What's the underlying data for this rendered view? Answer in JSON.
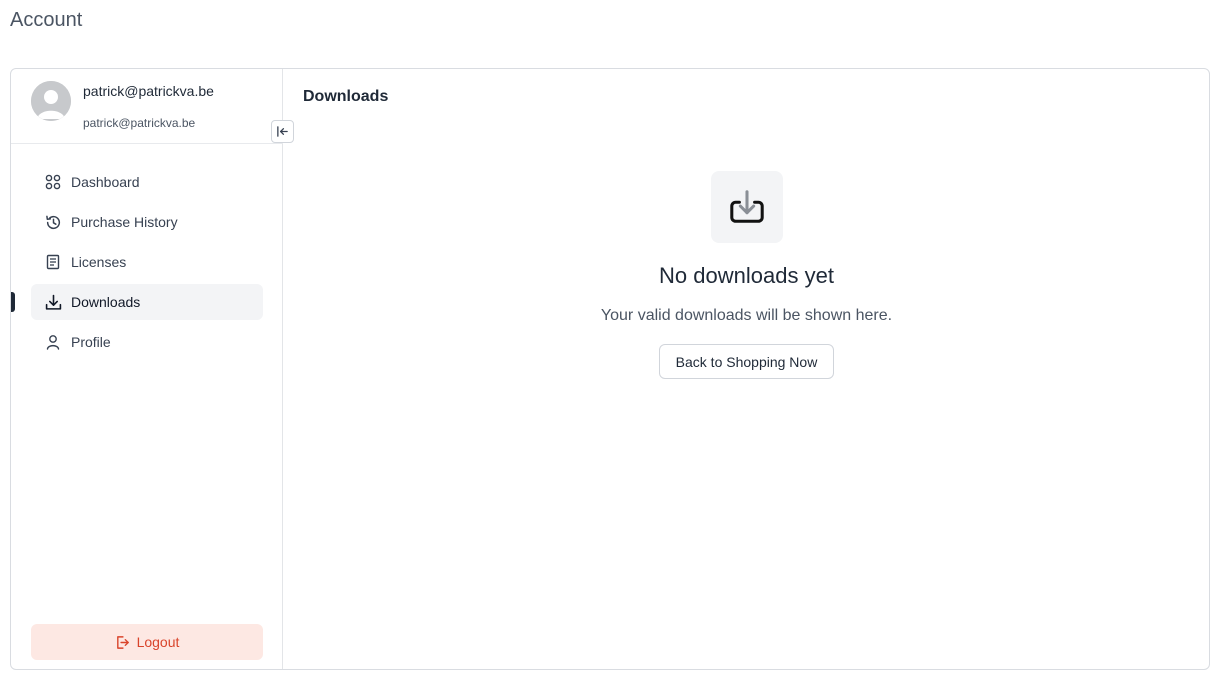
{
  "page": {
    "title": "Account"
  },
  "user": {
    "name": "patrick@patrickva.be",
    "email": "patrick@patrickva.be"
  },
  "sidebar": {
    "items": [
      {
        "label": "Dashboard",
        "icon": "grid-icon",
        "active": false
      },
      {
        "label": "Purchase History",
        "icon": "history-icon",
        "active": false
      },
      {
        "label": "Licenses",
        "icon": "document-icon",
        "active": false
      },
      {
        "label": "Downloads",
        "icon": "download-icon",
        "active": true
      },
      {
        "label": "Profile",
        "icon": "user-icon",
        "active": false
      }
    ],
    "logout_label": "Logout"
  },
  "main": {
    "section_title": "Downloads",
    "empty_state": {
      "title": "No downloads yet",
      "subtitle": "Your valid downloads will be shown here.",
      "button_label": "Back to Shopping Now",
      "icon": "download-tray-icon"
    }
  },
  "colors": {
    "logout_bg": "#fde8e3",
    "logout_text": "#d9442b",
    "active_bg": "#f3f4f6",
    "border": "#d9dce1"
  }
}
